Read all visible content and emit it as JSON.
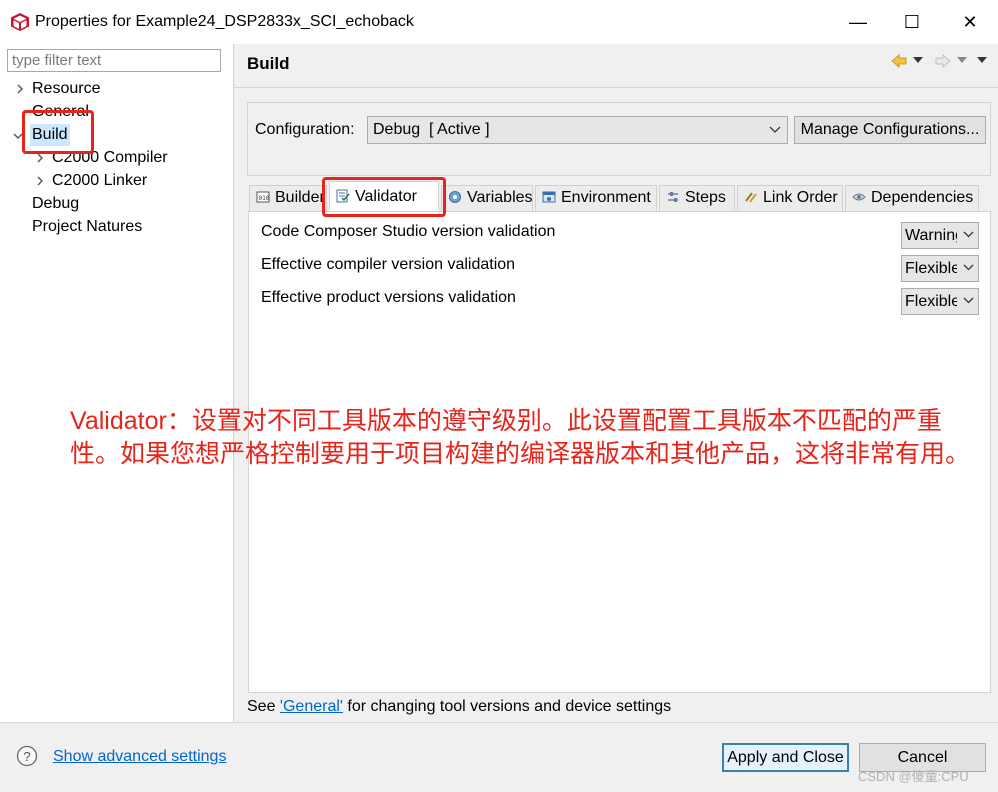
{
  "window": {
    "title": "Properties for Example24_DSP2833x_SCI_echoback",
    "minimize_glyph": "—",
    "maximize_glyph": "☐",
    "close_glyph": "✕"
  },
  "filter": {
    "placeholder": "type filter text"
  },
  "tree": [
    {
      "label": "Resource",
      "expanded": false,
      "depth": 0
    },
    {
      "label": "General",
      "depth": 0
    },
    {
      "label": "Build",
      "expanded": true,
      "selected": true,
      "depth": 0
    },
    {
      "label": "C2000 Compiler",
      "expanded": false,
      "depth": 1
    },
    {
      "label": "C2000 Linker",
      "expanded": false,
      "depth": 1
    },
    {
      "label": "Debug",
      "depth": 0
    },
    {
      "label": "Project Natures",
      "depth": 0
    }
  ],
  "page": {
    "heading": "Build"
  },
  "configuration": {
    "label": "Configuration:",
    "value": "Debug  [ Active ]",
    "manage_label": "Manage Configurations..."
  },
  "tabs": [
    {
      "label": "Builder",
      "icon": "builder-icon"
    },
    {
      "label": "Validator",
      "icon": "validator-icon",
      "active": true
    },
    {
      "label": "Variables",
      "icon": "variables-icon"
    },
    {
      "label": "Environment",
      "icon": "environment-icon"
    },
    {
      "label": "Steps",
      "icon": "steps-icon"
    },
    {
      "label": "Link Order",
      "icon": "link-order-icon"
    },
    {
      "label": "Dependencies",
      "icon": "dependencies-icon"
    }
  ],
  "validator": [
    {
      "label": "Code Composer Studio version validation",
      "value": "Warning"
    },
    {
      "label": "Effective compiler version validation",
      "value": "Flexible"
    },
    {
      "label": "Effective product versions validation",
      "value": "Flexible"
    }
  ],
  "annotation": {
    "line1": "Validator：设置对不同工具版本的遵守级别。此设置配置工具版本不匹配的严重",
    "line2": "性。如果您想严格控制要用于项目构建的编译器版本和其他产品，这将非常有用。"
  },
  "footer": {
    "prefix": "See ",
    "link": "'General'",
    "suffix": " for changing tool versions and device settings"
  },
  "bottom": {
    "advanced_link": "Show advanced settings",
    "apply_label": "Apply and Close",
    "cancel_label": "Cancel",
    "watermark": "CSDN @傻童:CPU"
  },
  "colors": {
    "annotation_red": "#e8231a",
    "link_blue": "#0066cc",
    "selection_bg": "#cce8ff"
  }
}
